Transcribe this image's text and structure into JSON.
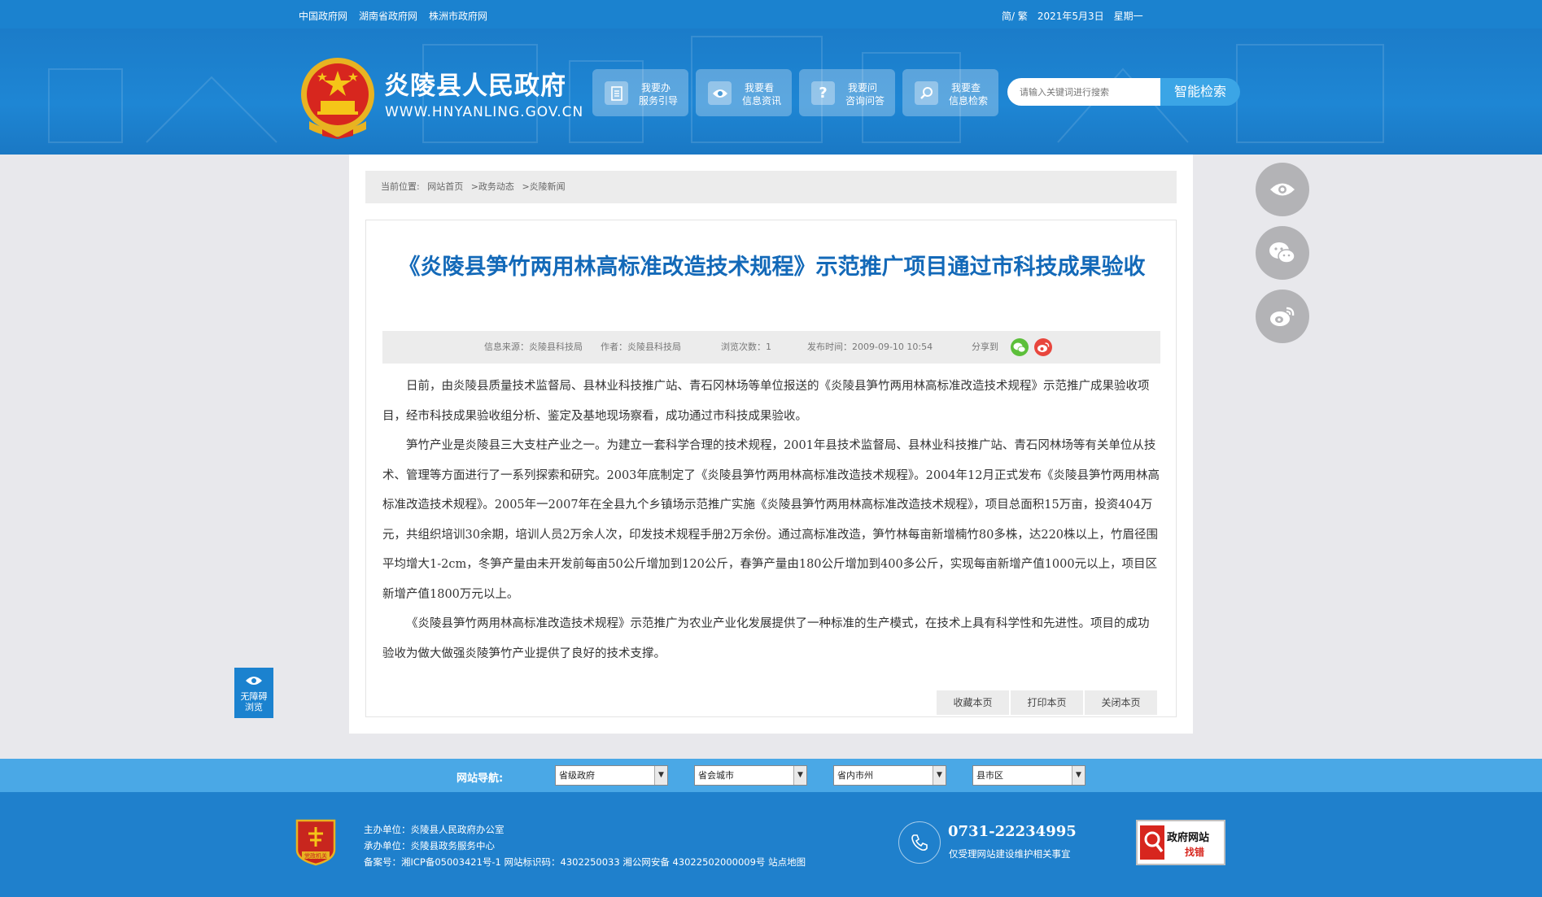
{
  "topbar": {
    "links": [
      "中国政府网",
      "湖南省政府网",
      "株洲市政府网"
    ],
    "lang": "简/ 繁",
    "date": "2021年5月3日",
    "weekday": "星期一"
  },
  "header": {
    "title": "炎陵县人民政府",
    "domain": "WWW.HNYANLING.GOV.CN",
    "services": [
      {
        "line1": "我要办",
        "line2": "服务引导",
        "icon": "document-icon"
      },
      {
        "line1": "我要看",
        "line2": "信息资讯",
        "icon": "eye-icon"
      },
      {
        "line1": "我要问",
        "line2": "咨询问答",
        "icon": "question-icon"
      },
      {
        "line1": "我要查",
        "line2": "信息检索",
        "icon": "search-icon"
      }
    ],
    "search_placeholder": "请输入关键词进行搜索",
    "search_button": "智能检索"
  },
  "breadcrumb": {
    "label": "当前位置:",
    "items": [
      "网站首页",
      ">政务动态",
      ">炎陵新闻"
    ]
  },
  "article": {
    "title": "《炎陵县笋竹两用林高标准改造技术规程》示范推广项目通过市科技成果验收",
    "meta": {
      "source": "信息来源：炎陵县科技局",
      "author": "作者：炎陵县科技局",
      "views": "浏览次数：1",
      "published": "发布时间：2009-09-10 10:54",
      "share": "分享到"
    },
    "paragraphs": [
      "日前，由炎陵县质量技术监督局、县林业科技推广站、青石冈林场等单位报送的《炎陵县笋竹两用林高标准改造技术规程》示范推广成果验收项目，经市科技成果验收组分析、鉴定及基地现场察看，成功通过市科技成果验收。",
      "笋竹产业是炎陵县三大支柱产业之一。为建立一套科学合理的技术规程，2001年县技术监督局、县林业科技推广站、青石冈林场等有关单位从技术、管理等方面进行了一系列探索和研究。2003年底制定了《炎陵县笋竹两用林高标准改造技术规程》。2004年12月正式发布《炎陵县笋竹两用林高标准改造技术规程》。2005年一2007年在全县九个乡镇场示范推广实施《炎陵县笋竹两用林高标准改造技术规程》，项目总面积15万亩，投资404万元，共组织培训30余期，培训人员2万余人次，印发技术规程手册2万余份。通过高标准改造，笋竹林每亩新增楠竹80多株，达220株以上，竹眉径围平均增大1-2cm，冬笋产量由未开发前每亩50公斤增加到120公斤，春笋产量由180公斤增加到400多公斤，实现每亩新增产值1000元以上，项目区新增产值1800万元以上。",
      "《炎陵县笋竹两用林高标准改造技术规程》示范推广为农业产业化发展提供了一种标准的生产模式，在技术上具有科学性和先进性。项目的成功验收为做大做强炎陵笋竹产业提供了良好的技术支撑。"
    ],
    "actions": [
      "收藏本页",
      "打印本页",
      "关闭本页"
    ]
  },
  "accessibility": {
    "line1": "无障碍",
    "line2": "浏览"
  },
  "site_nav": {
    "label": "网站导航:",
    "selects": [
      "省级政府",
      "省会城市",
      "省内市州",
      "县市区"
    ]
  },
  "footer": {
    "sponsor": "主办单位：炎陵县人民政府办公室",
    "organizer": "承办单位：炎陵县政务服务中心",
    "record": "备案号：湘ICP备05003421号-1 网站标识码：4302250033 湘公网安备 43022502000009号 站点地图",
    "badge_text": "党政机关",
    "phone": "0731-22234995",
    "phone_note": "仅受理网站建设维护相关事宜",
    "error_line1": "政府网站",
    "error_line2": "找错"
  }
}
